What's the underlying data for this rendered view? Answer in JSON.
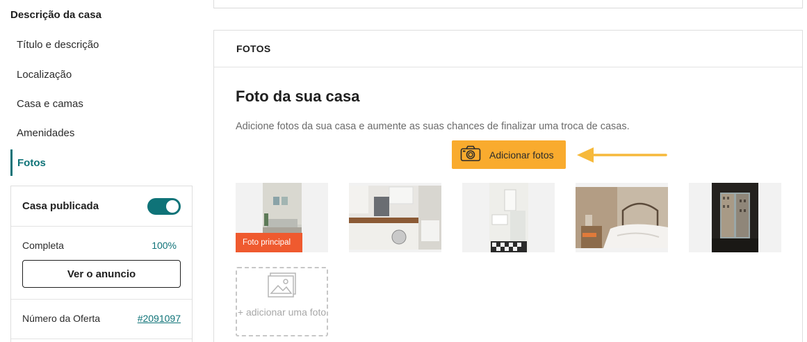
{
  "sidebar": {
    "section_title": "Descrição da casa",
    "items": [
      {
        "label": "Título e descrição"
      },
      {
        "label": "Localização"
      },
      {
        "label": "Casa e camas"
      },
      {
        "label": "Amenidades"
      },
      {
        "label": "Fotos",
        "active": true
      }
    ],
    "status": {
      "published_label": "Casa publicada",
      "published_on": true,
      "complete_label": "Completa",
      "complete_value": "100%",
      "view_button": "Ver o anuncio",
      "offer_label": "Número da Oferta",
      "offer_value": "#2091097"
    }
  },
  "main": {
    "section_header": "FOTOS",
    "title": "Foto da sua casa",
    "description": "Adicione fotos da sua casa e aumente as suas chances de finalizar uma troca de casas.",
    "add_button": {
      "label": "Adicionar fotos",
      "icon": "camera-icon"
    },
    "photos": [
      {
        "alt": "living room",
        "main": true,
        "badge": "Foto principal"
      },
      {
        "alt": "kitchen"
      },
      {
        "alt": "bathroom"
      },
      {
        "alt": "bedroom"
      },
      {
        "alt": "window view"
      }
    ],
    "add_tile_label": "+ adicionar uma foto"
  },
  "colors": {
    "accent": "#0f7378",
    "button": "#f9ab2e",
    "badge": "#ef5a2f",
    "arrow": "#f6b93b"
  }
}
